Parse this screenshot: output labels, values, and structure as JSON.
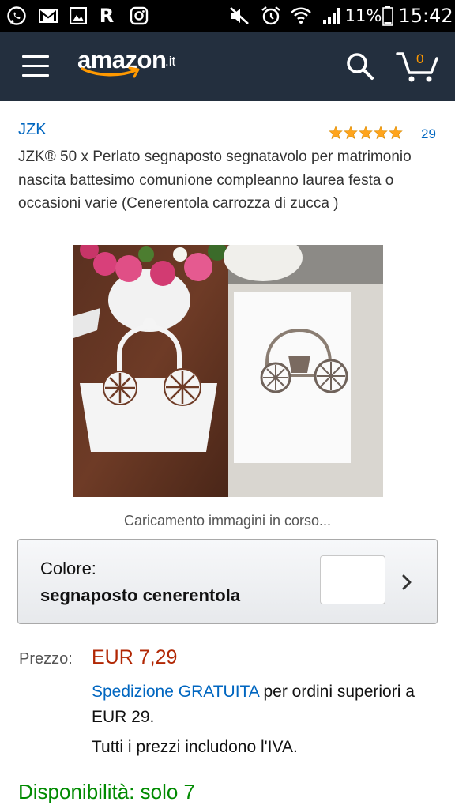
{
  "status_bar": {
    "icons": [
      "whatsapp-icon",
      "gmail-icon",
      "gallery-icon",
      "r-app-icon",
      "instagram-icon",
      "mute-icon",
      "alarm-icon",
      "wifi-icon",
      "signal-icon",
      "battery-icon"
    ],
    "r_app_letter": "R",
    "battery": "11%",
    "time": "15:42"
  },
  "header": {
    "logo_text": "amazon",
    "logo_tld": ".it",
    "cart_count": "0",
    "colors": {
      "bar": "#232f3e",
      "accent": "#ff9900"
    }
  },
  "product": {
    "brand": "JZK",
    "rating_stars": 5,
    "rating_count": "29",
    "title": "JZK® 50 x Perlato segnaposto segnatavolo per matrimonio nascita battesimo comunione compleanno laurea festa o occasioni varie (Cenerentola carrozza di zucca )",
    "loading_text": "Caricamento immagini in corso..."
  },
  "variation": {
    "label": "Colore:",
    "value": "segnaposto cenerentola"
  },
  "pricing": {
    "label": "Prezzo:",
    "price": "EUR 7,29",
    "shipping_link": "Spedizione GRATUITA",
    "shipping_rest": " per ordini superiori a EUR 29.",
    "vat_note": "Tutti i prezzi includono l'IVA."
  },
  "availability": "Disponibilità: solo 7",
  "colors": {
    "link": "#0066c0",
    "price": "#b12704",
    "in_stock": "#008a00",
    "star": "#ffa41c"
  }
}
